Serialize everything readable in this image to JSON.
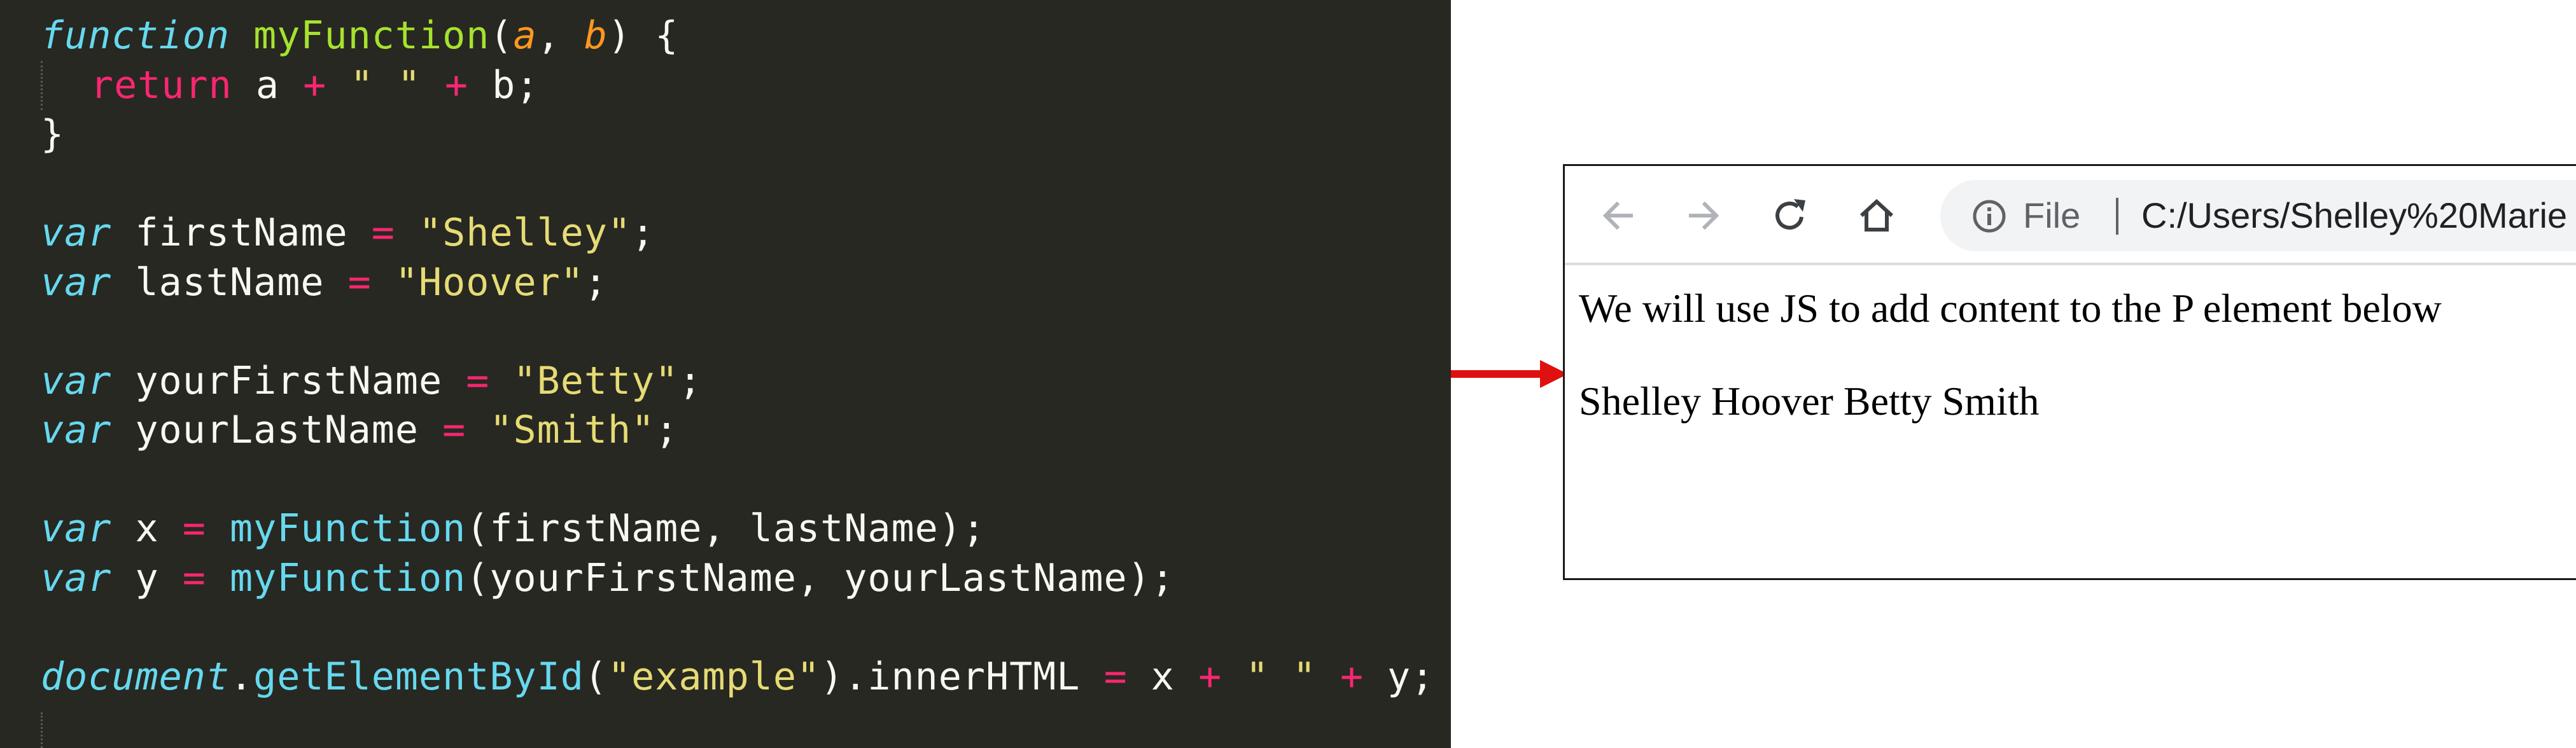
{
  "code_lines": [
    [
      {
        "t": "function",
        "c": "kw-i"
      },
      {
        "t": " ",
        "c": "plain"
      },
      {
        "t": "myFunction",
        "c": "fn"
      },
      {
        "t": "(",
        "c": "plain"
      },
      {
        "t": "a",
        "c": "param"
      },
      {
        "t": ", ",
        "c": "plain"
      },
      {
        "t": "b",
        "c": "param"
      },
      {
        "t": ") {",
        "c": "plain"
      }
    ],
    [
      {
        "t": "return",
        "c": "kw"
      },
      {
        "t": " a ",
        "c": "plain"
      },
      {
        "t": "+",
        "c": "op"
      },
      {
        "t": " ",
        "c": "plain"
      },
      {
        "t": "\" \"",
        "c": "str"
      },
      {
        "t": " ",
        "c": "plain"
      },
      {
        "t": "+",
        "c": "op"
      },
      {
        "t": " b;",
        "c": "plain"
      }
    ],
    [
      {
        "t": "}",
        "c": "plain"
      }
    ],
    [],
    [
      {
        "t": "var",
        "c": "kw-i"
      },
      {
        "t": " firstName ",
        "c": "plain"
      },
      {
        "t": "=",
        "c": "op"
      },
      {
        "t": " ",
        "c": "plain"
      },
      {
        "t": "\"Shelley\"",
        "c": "str"
      },
      {
        "t": ";",
        "c": "plain"
      }
    ],
    [
      {
        "t": "var",
        "c": "kw-i"
      },
      {
        "t": " lastName ",
        "c": "plain"
      },
      {
        "t": "=",
        "c": "op"
      },
      {
        "t": " ",
        "c": "plain"
      },
      {
        "t": "\"Hoover\"",
        "c": "str"
      },
      {
        "t": ";",
        "c": "plain"
      }
    ],
    [],
    [
      {
        "t": "var",
        "c": "kw-i"
      },
      {
        "t": " yourFirstName ",
        "c": "plain"
      },
      {
        "t": "=",
        "c": "op"
      },
      {
        "t": " ",
        "c": "plain"
      },
      {
        "t": "\"Betty\"",
        "c": "str"
      },
      {
        "t": ";",
        "c": "plain"
      }
    ],
    [
      {
        "t": "var",
        "c": "kw-i"
      },
      {
        "t": " yourLastName ",
        "c": "plain"
      },
      {
        "t": "=",
        "c": "op"
      },
      {
        "t": " ",
        "c": "plain"
      },
      {
        "t": "\"Smith\"",
        "c": "str"
      },
      {
        "t": ";",
        "c": "plain"
      }
    ],
    [],
    [
      {
        "t": "var",
        "c": "kw-i"
      },
      {
        "t": " x ",
        "c": "plain"
      },
      {
        "t": "=",
        "c": "op"
      },
      {
        "t": " ",
        "c": "plain"
      },
      {
        "t": "myFunction",
        "c": "call"
      },
      {
        "t": "(firstName, lastName);",
        "c": "plain"
      }
    ],
    [
      {
        "t": "var",
        "c": "kw-i"
      },
      {
        "t": " y ",
        "c": "plain"
      },
      {
        "t": "=",
        "c": "op"
      },
      {
        "t": " ",
        "c": "plain"
      },
      {
        "t": "myFunction",
        "c": "call"
      },
      {
        "t": "(yourFirstName, yourLastName);",
        "c": "plain"
      }
    ],
    [],
    [
      {
        "t": "document",
        "c": "kw-i"
      },
      {
        "t": ".",
        "c": "plain"
      },
      {
        "t": "getElementById",
        "c": "call"
      },
      {
        "t": "(",
        "c": "plain"
      },
      {
        "t": "\"example\"",
        "c": "str"
      },
      {
        "t": ").innerHTML ",
        "c": "plain"
      },
      {
        "t": "=",
        "c": "op"
      },
      {
        "t": " x ",
        "c": "plain"
      },
      {
        "t": "+",
        "c": "op"
      },
      {
        "t": " ",
        "c": "plain"
      },
      {
        "t": "\" \"",
        "c": "str"
      },
      {
        "t": " ",
        "c": "plain"
      },
      {
        "t": "+",
        "c": "op"
      },
      {
        "t": " y;",
        "c": "plain"
      }
    ]
  ],
  "colors": {
    "editor_bg": "#272822",
    "arrow": "#e01010",
    "toolbar_border": "#dadce0",
    "omnibox_bg": "#f1f3f4"
  },
  "browser": {
    "toolbar": {
      "back_icon": "arrow-left-icon",
      "forward_icon": "arrow-right-icon",
      "reload_icon": "reload-icon",
      "home_icon": "home-icon",
      "info_icon": "info-circle-icon",
      "file_label": "File",
      "url": "C:/Users/Shelley%20Marie"
    },
    "page": {
      "intro_text": "We will use JS to add content to the P element below",
      "example_text": "Shelley Hoover Betty Smith"
    }
  }
}
